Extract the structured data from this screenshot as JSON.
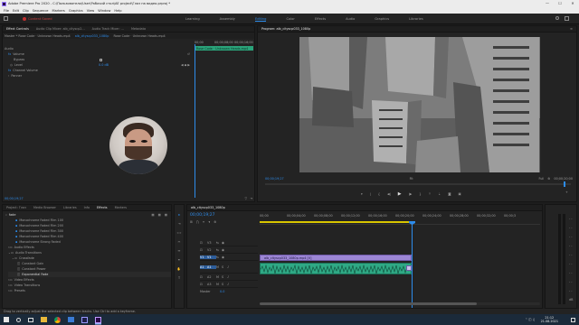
{
  "window": {
    "title": "Adobe Premiere Pro 2020 - C:\\Пользователи\\User\\Рабочий стол\\AE project\\Глаз на видео.prproj *",
    "minimize": "—",
    "maximize": "☐",
    "close": "✕"
  },
  "menu": [
    "File",
    "Edit",
    "Clip",
    "Sequence",
    "Markers",
    "Graphics",
    "View",
    "Window",
    "Help"
  ],
  "workspace": {
    "alert": "Content Saved",
    "tabs": [
      "Learning",
      "Assembly",
      "Editing",
      "Color",
      "Effects",
      "Audio",
      "Graphics",
      "Libraries"
    ],
    "active": "Editing"
  },
  "effect_controls": {
    "tabs": [
      "Effect Controls",
      "Audio Clip Mixer: alb_cityscp2...",
      "Audio Track Mixer: ...",
      "Metadata"
    ],
    "header_left": "Master * Rose Code · Unknown Heads.mp4",
    "header_clip": "alb_cityscp033_1080p",
    "header_seq": "Rose Code · Unknown Heads.mp4",
    "ruler": [
      "00;00",
      "00;00;08;00",
      "00;00;16;00"
    ],
    "section": "Audio",
    "params": [
      {
        "name": "Volume",
        "value": ""
      },
      {
        "name": "Bypass",
        "value": ""
      },
      {
        "name": "Level",
        "value": "0.0 dB"
      },
      {
        "name": "Channel Volume",
        "value": ""
      },
      {
        "name": "Panner",
        "value": ""
      }
    ],
    "clip_label": "Rose Code · Unknown Heads.mp4",
    "timecode": "00;00;19;27"
  },
  "program": {
    "title": "Program: alb_cityscp033_1080p",
    "timecode": "00;00;19;27",
    "fit": "Fit",
    "full": "Full",
    "duration": "00;00;20;00"
  },
  "project": {
    "tabs": [
      "Project: Глаз",
      "Media Browser",
      "Libraries",
      "Info",
      "Effects",
      "Markers"
    ],
    "active_tab": "Effects",
    "search": "fade",
    "items": [
      "Monochrome Faded Film 100",
      "Monochrome Faded Film 200",
      "Monochrome Faded Film 300",
      "Monochrome Faded Film 400",
      "Monochrome Strong Faded",
      "Audio Effects",
      "Audio Transitions",
      "Crossfade",
      "Constant Gain",
      "Constant Power",
      "Exponential Fade",
      "Video Effects",
      "Video Transitions",
      "Presets"
    ]
  },
  "timeline": {
    "tab": "alb_cityscp033_1080p",
    "timecode": "00;00;19;27",
    "ruler": [
      "00;00",
      "00;00;04;00",
      "00;00;08;00",
      "00;00;12;00",
      "00;00;16;00",
      "00;00;20;00",
      "00;00;24;00",
      "00;00;28;00",
      "00;00;32;00",
      "00;00;3"
    ],
    "tracks": [
      "V3",
      "V2",
      "V1",
      "A1",
      "A2",
      "A3"
    ],
    "master": "Master",
    "master_val": "0.0",
    "video_clip": "alb_cityscp033_1080p.mp4 [V]",
    "audio_clip": "",
    "status": "Drag to vertically adjust the selected clip between tracks. Use Ctrl to add a keyframe."
  },
  "taskbar": {
    "time": "21:12",
    "date": "21.08.2021"
  }
}
